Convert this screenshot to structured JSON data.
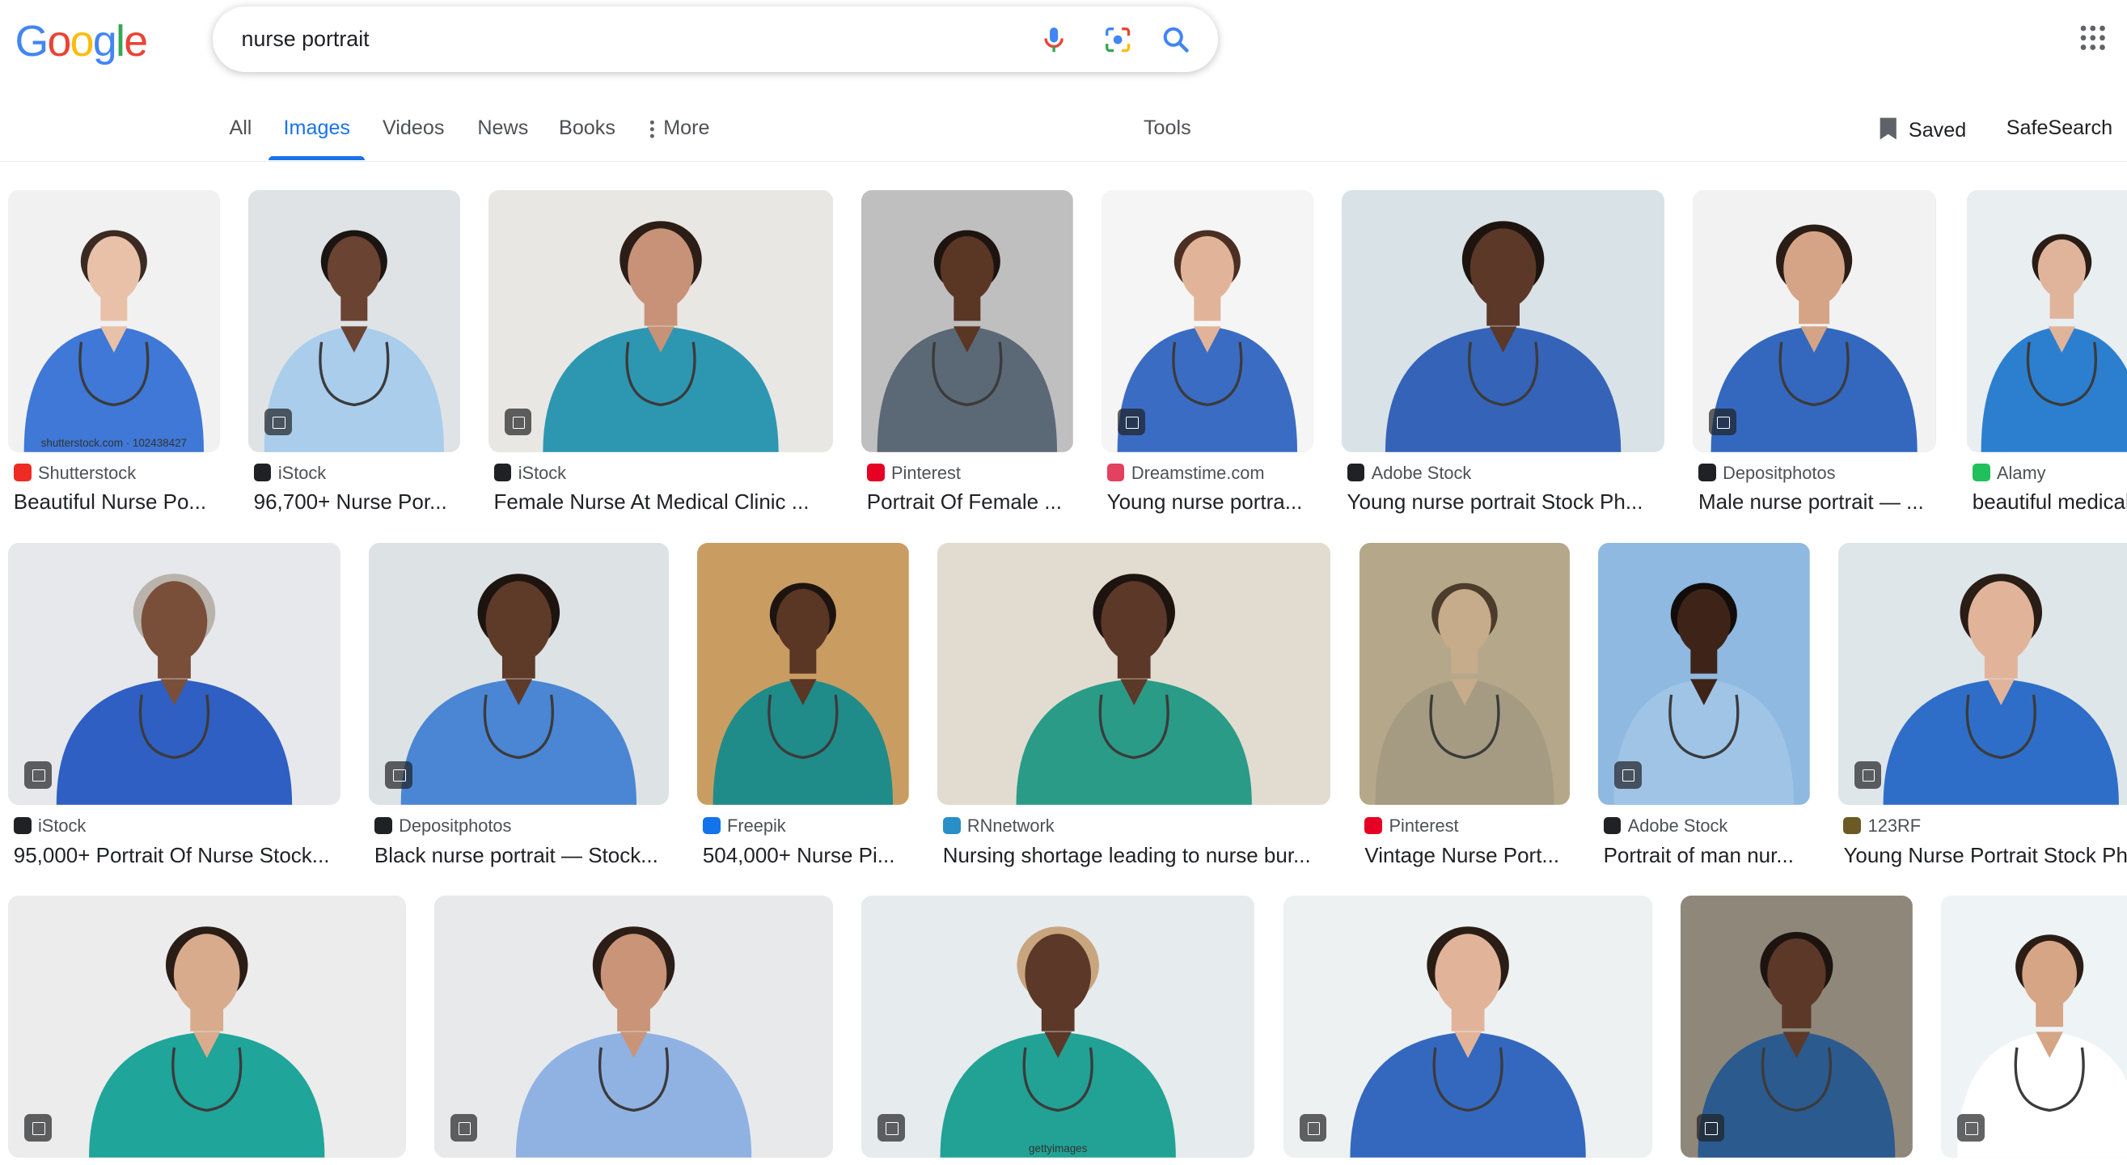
{
  "search": {
    "query": "nurse portrait"
  },
  "logo": {
    "letters": [
      "G",
      "o",
      "o",
      "g",
      "l",
      "e"
    ],
    "colors": [
      "#4285F4",
      "#EA4335",
      "#FBBC05",
      "#4285F4",
      "#34A853",
      "#EA4335"
    ]
  },
  "tabs": [
    {
      "label": "All",
      "active": false
    },
    {
      "label": "Images",
      "active": true
    },
    {
      "label": "Videos",
      "active": false
    },
    {
      "label": "News",
      "active": false
    },
    {
      "label": "Books",
      "active": false
    },
    {
      "label": "More",
      "active": false
    }
  ],
  "tools_label": "Tools",
  "saved_label": "Saved",
  "safesearch_label": "SafeSearch",
  "results": [
    {
      "source": "Shutterstock",
      "title": "Beautiful Nurse Po...",
      "fav_color": "#ee2b24",
      "scrub": "#3f78d6",
      "bg": "#f1f1f1",
      "skin": "#e8c1a8",
      "hair": "#3a2a22",
      "watermark": "shutterstock.com · 102438427"
    },
    {
      "source": "iStock",
      "title": "96,700+ Nurse Por...",
      "fav_color": "#202124",
      "scrub": "#a9cdeb",
      "bg": "#dfe3e6",
      "skin": "#6b4332",
      "hair": "#1b1512"
    },
    {
      "source": "iStock",
      "title": "Female Nurse At Medical Clinic ...",
      "fav_color": "#202124",
      "scrub": "#2d97b2",
      "bg": "#e9e7e4",
      "skin": "#c79277",
      "hair": "#2c1d17"
    },
    {
      "source": "Pinterest",
      "title": "Portrait Of Female ...",
      "fav_color": "#e60023",
      "scrub": "#5b6875",
      "bg": "#bfbfbf",
      "skin": "#5a3625",
      "hair": "#1d1410"
    },
    {
      "source": "Dreamstime.com",
      "title": "Young nurse portra...",
      "fav_color": "#e4405f",
      "scrub": "#3b6cc3",
      "bg": "#f5f5f5",
      "skin": "#e1b49a",
      "hair": "#4b2f22"
    },
    {
      "source": "Adobe Stock",
      "title": "Young nurse portrait Stock Ph...",
      "fav_color": "#202124",
      "scrub": "#3563b8",
      "bg": "#d8e2e7",
      "skin": "#5c3828",
      "hair": "#1d1410"
    },
    {
      "source": "Depositphotos",
      "title": "Male nurse portrait — ...",
      "fav_color": "#202124",
      "scrub": "#3468bf",
      "bg": "#f2f2f2",
      "skin": "#d5a487",
      "hair": "#2a1d16"
    },
    {
      "source": "Alamy",
      "title": "beautiful medical",
      "fav_color": "#20c05c",
      "scrub": "#2c7fcf",
      "bg": "#e9eef1",
      "skin": "#e0b49b",
      "hair": "#2a1d16"
    },
    {
      "source": "iStock",
      "title": "95,000+ Portrait Of Nurse Stock...",
      "fav_color": "#202124",
      "scrub": "#2f5fc2",
      "bg": "#e6e8eb",
      "skin": "#7a4f3a",
      "hair": "#b9b3ac"
    },
    {
      "source": "Depositphotos",
      "title": "Black nurse portrait — Stock...",
      "fav_color": "#202124",
      "scrub": "#4a86d3",
      "bg": "#dde2e5",
      "skin": "#5e3a29",
      "hair": "#1d1410"
    },
    {
      "source": "Freepik",
      "title": "504,000+ Nurse Pi...",
      "fav_color": "#1273eb",
      "scrub": "#1f8c89",
      "bg": "#c99d62",
      "skin": "#5a3625",
      "hair": "#1d1410"
    },
    {
      "source": "RNnetwork",
      "title": "Nursing shortage leading to nurse bur...",
      "fav_color": "#2a8fc6",
      "scrub": "#2a9b86",
      "bg": "#e2dcd0",
      "skin": "#5c3828",
      "hair": "#1d1410"
    },
    {
      "source": "Pinterest",
      "title": "Vintage Nurse Port...",
      "fav_color": "#e60023",
      "scrub": "#a59b82",
      "bg": "#b5a789",
      "skin": "#c6ac8a",
      "hair": "#4c3c2c"
    },
    {
      "source": "Adobe Stock",
      "title": "Portrait of man nur...",
      "fav_color": "#202124",
      "scrub": "#9fc4e6",
      "bg": "#8fb9e0",
      "skin": "#3e2418",
      "hair": "#120d0a"
    },
    {
      "source": "123RF",
      "title": "Young Nurse Portrait Stock Ph",
      "fav_color": "#6b5a23",
      "scrub": "#2e6ec8",
      "bg": "#dfe6ea",
      "skin": "#e1b49a",
      "hair": "#2a1d16"
    },
    {
      "source": "",
      "title": "",
      "fav_color": "#ffffff",
      "scrub": "#1fa59a",
      "bg": "#ececec",
      "skin": "#d8ab8c",
      "hair": "#2a1d16"
    },
    {
      "source": "",
      "title": "",
      "fav_color": "#ffffff",
      "scrub": "#8fb2e3",
      "bg": "#e8e9eb",
      "skin": "#c99477",
      "hair": "#2c1d17"
    },
    {
      "source": "",
      "title": "",
      "fav_color": "#ffffff",
      "scrub": "#21a294",
      "bg": "#e6ebee",
      "skin": "#5c3828",
      "hair": "#c9a57f",
      "watermark": "gettyimages"
    },
    {
      "source": "",
      "title": "",
      "fav_color": "#ffffff",
      "scrub": "#3468bf",
      "bg": "#eef1f2",
      "skin": "#e1b49a",
      "hair": "#2a1d16"
    },
    {
      "source": "",
      "title": "",
      "fav_color": "#ffffff",
      "scrub": "#2b5a8e",
      "bg": "#8f8779",
      "skin": "#5c3828",
      "hair": "#1d1410"
    },
    {
      "source": "",
      "title": "",
      "fav_color": "#ffffff",
      "scrub": "#ffffff",
      "bg": "#eef3f5",
      "skin": "#d6a585",
      "hair": "#2a1d16"
    }
  ]
}
